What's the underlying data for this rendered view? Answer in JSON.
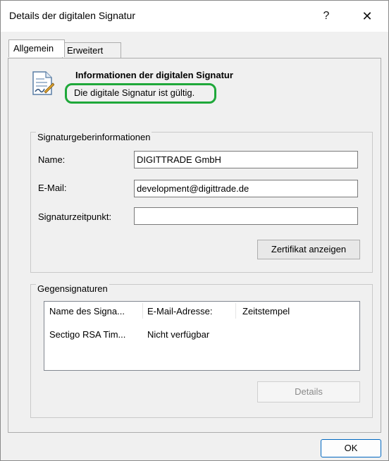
{
  "window": {
    "title": "Details der digitalen Signatur",
    "help_glyph": "?",
    "close_glyph": "✕"
  },
  "tabs": [
    "Allgemein",
    "Erweitert"
  ],
  "info": {
    "title": "Informationen der digitalen Signatur",
    "status": "Die digitale Signatur ist gültig."
  },
  "signer": {
    "group_label": "Signaturgeberinformationen",
    "name_label": "Name:",
    "name_value": "DIGITTRADE GmbH",
    "email_label": "E-Mail:",
    "email_value": "development@digittrade.de",
    "time_label": "Signaturzeitpunkt:",
    "time_value": "",
    "view_cert_button": "Zertifikat anzeigen"
  },
  "countersignatures": {
    "group_label": "Gegensignaturen",
    "columns": [
      "Name des Signa...",
      "E-Mail-Adresse:",
      "Zeitstempel"
    ],
    "rows": [
      [
        "Sectigo RSA Tim...",
        "Nicht verfügbar",
        ""
      ]
    ],
    "details_button": "Details"
  },
  "footer": {
    "ok_button": "OK"
  },
  "colors": {
    "highlight": "#1fa83a",
    "ok_border": "#0067c0"
  }
}
